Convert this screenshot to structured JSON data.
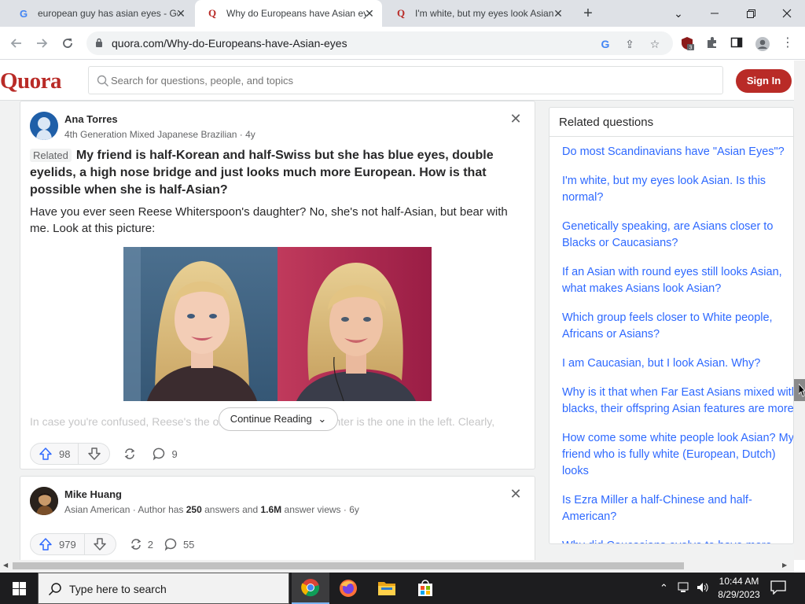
{
  "browser": {
    "tabs": [
      {
        "title": "european guy has asian eyes - Go",
        "favicon": "google-icon"
      },
      {
        "title": "Why do Europeans have Asian ey",
        "favicon": "quora-icon"
      },
      {
        "title": "I'm white, but my eyes look Asian",
        "favicon": "quora-icon"
      }
    ],
    "url": "quora.com/Why-do-Europeans-have-Asian-eyes",
    "extension_badge": "3"
  },
  "quora": {
    "logo": "Quora",
    "search_placeholder": "Search for questions, people, and topics",
    "sign_in": "Sign In"
  },
  "answers": [
    {
      "author": "Ana Torres",
      "credential": "4th Generation Mixed Japanese Brazilian · 4y",
      "related_label": "Related",
      "question": "My friend is half-Korean and half-Swiss but she has blue eyes, double eyelids, a high nose bridge and just looks much more European. How is that possible when she is half-Asian?",
      "text": "Have you ever seen Reese Whiterspoon's daughter? No, she's not half-Asian, but bear with me. Look at this picture:",
      "faded_text": "In case you're confused, Reese's the one in the right, the daughter is the one in the left. Clearly,",
      "continue_label": "Continue Reading",
      "upvotes": "98",
      "shares": "",
      "comments": "9"
    },
    {
      "author": "Mike Huang",
      "credential_prefix": "Asian American · Author has ",
      "answers_count": "250",
      "credential_mid": " answers and ",
      "views": "1.6M",
      "credential_suffix": " answer views · 6y",
      "upvotes": "979",
      "shares": "2",
      "comments": "55"
    }
  ],
  "related": {
    "heading": "Related questions",
    "items": [
      "Do most Scandinavians have \"Asian Eyes\"?",
      "I'm white, but my eyes look Asian. Is this normal?",
      "Genetically speaking, are Asians closer to Blacks or Caucasians?",
      "If an Asian with round eyes still looks Asian, what makes Asians look Asian?",
      "Which group feels closer to White people, Africans or Asians?",
      "I am Caucasian, but I look Asian. Why?",
      "Why is it that when Far East Asians mixed with blacks, their offspring Asian features are more",
      "How come some white people look Asian? My friend who is fully white (European, Dutch) looks",
      "Is Ezra Miller a half-Chinese and half-American?",
      "Why did Caucasians evolve to have more deep-set eyes compared to Asians?"
    ]
  },
  "taskbar": {
    "search_placeholder": "Type here to search",
    "time": "10:44 AM",
    "date": "8/29/2023"
  },
  "colors": {
    "quora_red": "#b92b27",
    "link_blue": "#2e69ff",
    "taskbar": "#1d1d1f"
  }
}
